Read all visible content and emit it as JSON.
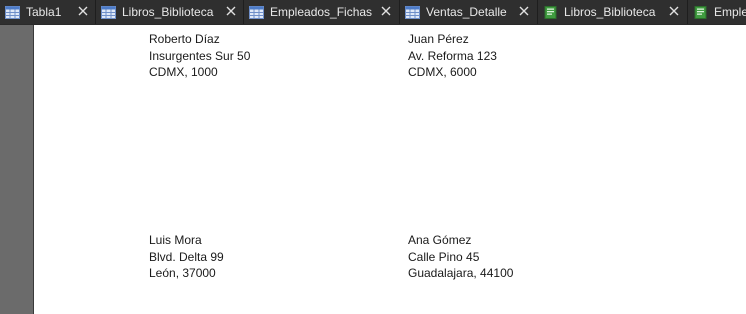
{
  "tabs": [
    {
      "label": "Tabla1",
      "icon": "table-icon"
    },
    {
      "label": "Libros_Biblioteca",
      "icon": "table-icon"
    },
    {
      "label": "Empleados_Fichas",
      "icon": "table-icon"
    },
    {
      "label": "Ventas_Detalle",
      "icon": "table-icon"
    },
    {
      "label": "Libros_Biblioteca",
      "icon": "report-icon"
    },
    {
      "label": "Emple",
      "icon": "report-icon"
    }
  ],
  "labels": [
    {
      "name": "Roberto Díaz",
      "street": "Insurgentes Sur 50",
      "city": "CDMX, 1000"
    },
    {
      "name": "Juan Pérez",
      "street": "Av. Reforma 123",
      "city": "CDMX, 6000"
    },
    {
      "name": "Luis Mora",
      "street": "Blvd. Delta 99",
      "city": "León, 37000"
    },
    {
      "name": "Ana Gómez",
      "street": "Calle Pino 45",
      "city": "Guadalajara, 44100"
    }
  ]
}
